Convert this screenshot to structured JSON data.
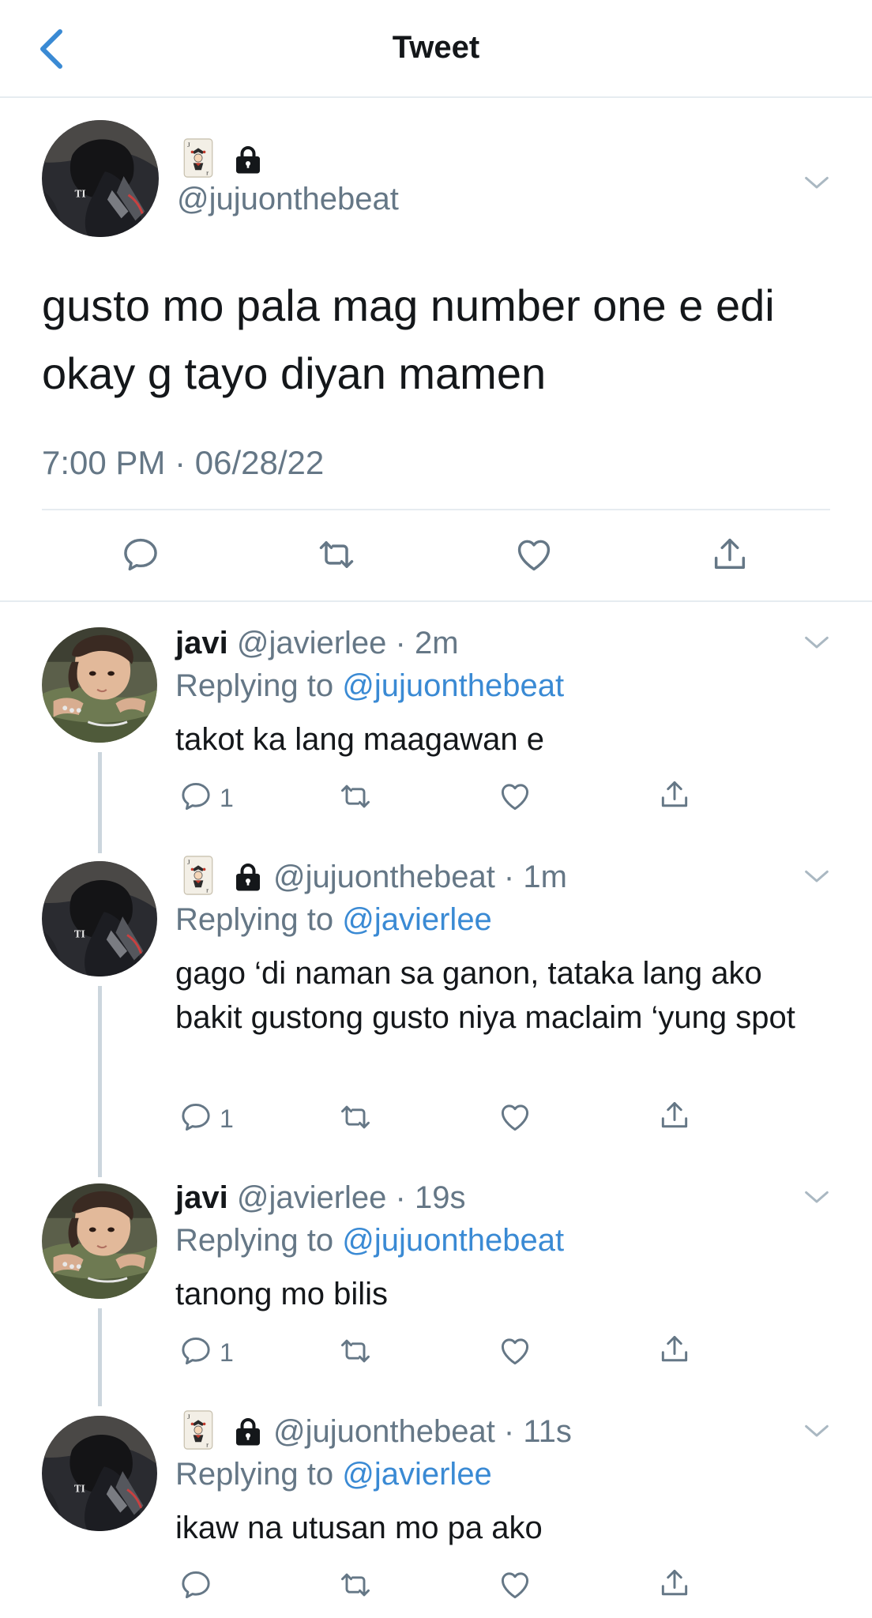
{
  "header": {
    "title": "Tweet",
    "back_icon": "chevron-left-icon"
  },
  "main_tweet": {
    "handle": "@jujuonthebeat",
    "text": "gusto mo pala mag number one e edi okay g tayo diyan mamen",
    "timestamp": "7:00 PM · 06/28/22",
    "badges": [
      "joker-card-emoji",
      "lock-icon"
    ]
  },
  "replies": [
    {
      "name": "javi",
      "meta": "@javierlee · 2m",
      "replying_label": "Replying to ",
      "replying_to": "@jujuonthebeat",
      "text": "takot ka lang maagawan e",
      "reply_count": "1"
    },
    {
      "name": "",
      "meta": "@jujuonthebeat · 1m",
      "replying_label": "Replying to ",
      "replying_to": "@javierlee",
      "text": "gago ‘di naman sa ganon, tataka lang ako bakit gustong gusto niya maclaim ‘yung spot",
      "reply_count": "1"
    },
    {
      "name": "javi",
      "meta": "@javierlee · 19s",
      "replying_label": "Replying to ",
      "replying_to": "@jujuonthebeat",
      "text": "tanong mo bilis",
      "reply_count": "1"
    },
    {
      "name": "",
      "meta": "@jujuonthebeat · 11s",
      "replying_label": "Replying to ",
      "replying_to": "@javierlee",
      "text": "ikaw na utusan mo pa ako",
      "reply_count": ""
    }
  ],
  "colors": {
    "accent": "#3a8ad4",
    "secondary_text": "#657786",
    "divider": "#e6ecf0"
  }
}
